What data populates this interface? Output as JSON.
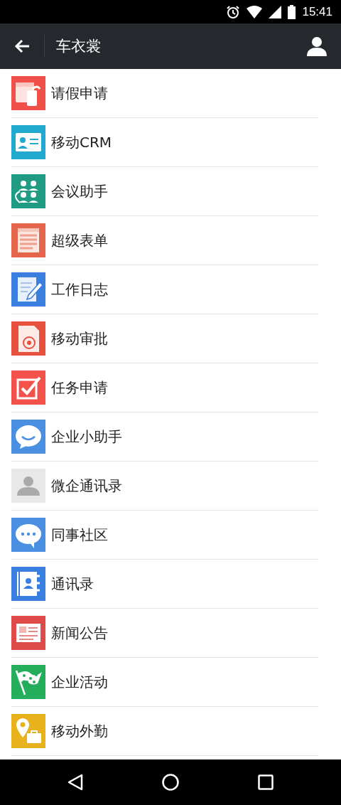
{
  "status_bar": {
    "time": "15:41"
  },
  "app_bar": {
    "title": "车衣裳"
  },
  "items": [
    {
      "label": "请假申请",
      "kind": "leave",
      "color": "#f0504a"
    },
    {
      "label": "移动CRM",
      "kind": "crm",
      "color": "#22a9cf"
    },
    {
      "label": "会议助手",
      "kind": "meeting",
      "color": "#1f9b84"
    },
    {
      "label": "超级表单",
      "kind": "form",
      "color": "#e4644c"
    },
    {
      "label": "工作日志",
      "kind": "log",
      "color": "#3a7ee0"
    },
    {
      "label": "移动审批",
      "kind": "approval",
      "color": "#e8503e"
    },
    {
      "label": "任务申请",
      "kind": "task",
      "color": "#f2524a"
    },
    {
      "label": "企业小助手",
      "kind": "assistant",
      "color": "#4a8fe2"
    },
    {
      "label": "微企通讯录",
      "kind": "contacts",
      "color": "#e8e8e8"
    },
    {
      "label": "同事社区",
      "kind": "community",
      "color": "#4a8fe2"
    },
    {
      "label": "通讯录",
      "kind": "addressbook",
      "color": "#3a7ee0"
    },
    {
      "label": "新闻公告",
      "kind": "news",
      "color": "#de4b48"
    },
    {
      "label": "企业活动",
      "kind": "activity",
      "color": "#24ad5a"
    },
    {
      "label": "移动外勤",
      "kind": "field",
      "color": "#e8b21c"
    }
  ]
}
